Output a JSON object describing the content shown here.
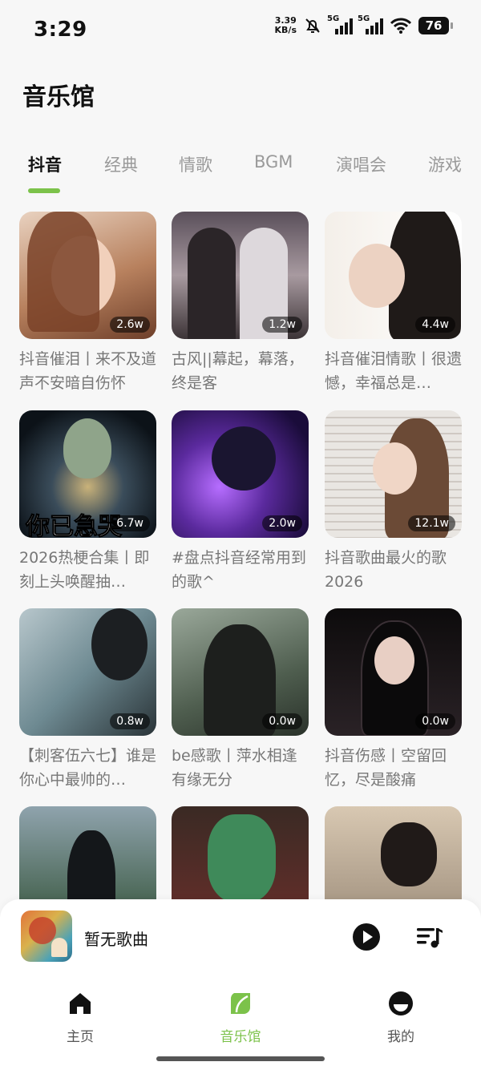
{
  "status_bar": {
    "time": "3:29",
    "net_speed": "3.39",
    "net_unit": "KB/s",
    "sim1_label": "5G",
    "sim2_label": "5G",
    "battery": "76"
  },
  "page": {
    "title": "音乐馆"
  },
  "tabs": [
    {
      "label": "抖音",
      "active": true
    },
    {
      "label": "经典",
      "active": false
    },
    {
      "label": "情歌",
      "active": false
    },
    {
      "label": "BGM",
      "active": false
    },
    {
      "label": "演唱会",
      "active": false
    },
    {
      "label": "游戏",
      "active": false
    }
  ],
  "playlists": [
    {
      "count": "2.6w",
      "title": "抖音催泪丨来不及道声不安暗自伤怀"
    },
    {
      "count": "1.2w",
      "title": "古风||幕起，幕落，终是客"
    },
    {
      "count": "4.4w",
      "title": "抖音催泪情歌丨很遗憾，幸福总是…"
    },
    {
      "count": "6.7w",
      "title": "2026热梗合集丨即刻上头唤醒抽…",
      "overlay": "你已急哭"
    },
    {
      "count": "2.0w",
      "title": "#盘点抖音经常用到的歌^"
    },
    {
      "count": "12.1w",
      "title": "抖音歌曲最火的歌2026"
    },
    {
      "count": "0.8w",
      "title": "【刺客伍六七】谁是你心中最帅的…"
    },
    {
      "count": "0.0w",
      "title": "be感歌丨萍水相逢有缘无分"
    },
    {
      "count": "0.0w",
      "title": "抖音伤感丨空留回忆，尽是酸痛"
    },
    {
      "count": "",
      "title": ""
    },
    {
      "count": "",
      "title": ""
    },
    {
      "count": "",
      "title": ""
    }
  ],
  "player": {
    "title": "暂无歌曲",
    "play_icon": "play-icon",
    "playlist_icon": "playlist-icon"
  },
  "nav": [
    {
      "label": "主页",
      "icon": "home-icon"
    },
    {
      "label": "音乐馆",
      "icon": "music-hall-icon"
    },
    {
      "label": "我的",
      "icon": "profile-icon"
    }
  ],
  "colors": {
    "accent": "#7cc24a",
    "background": "#f7f7f7"
  }
}
